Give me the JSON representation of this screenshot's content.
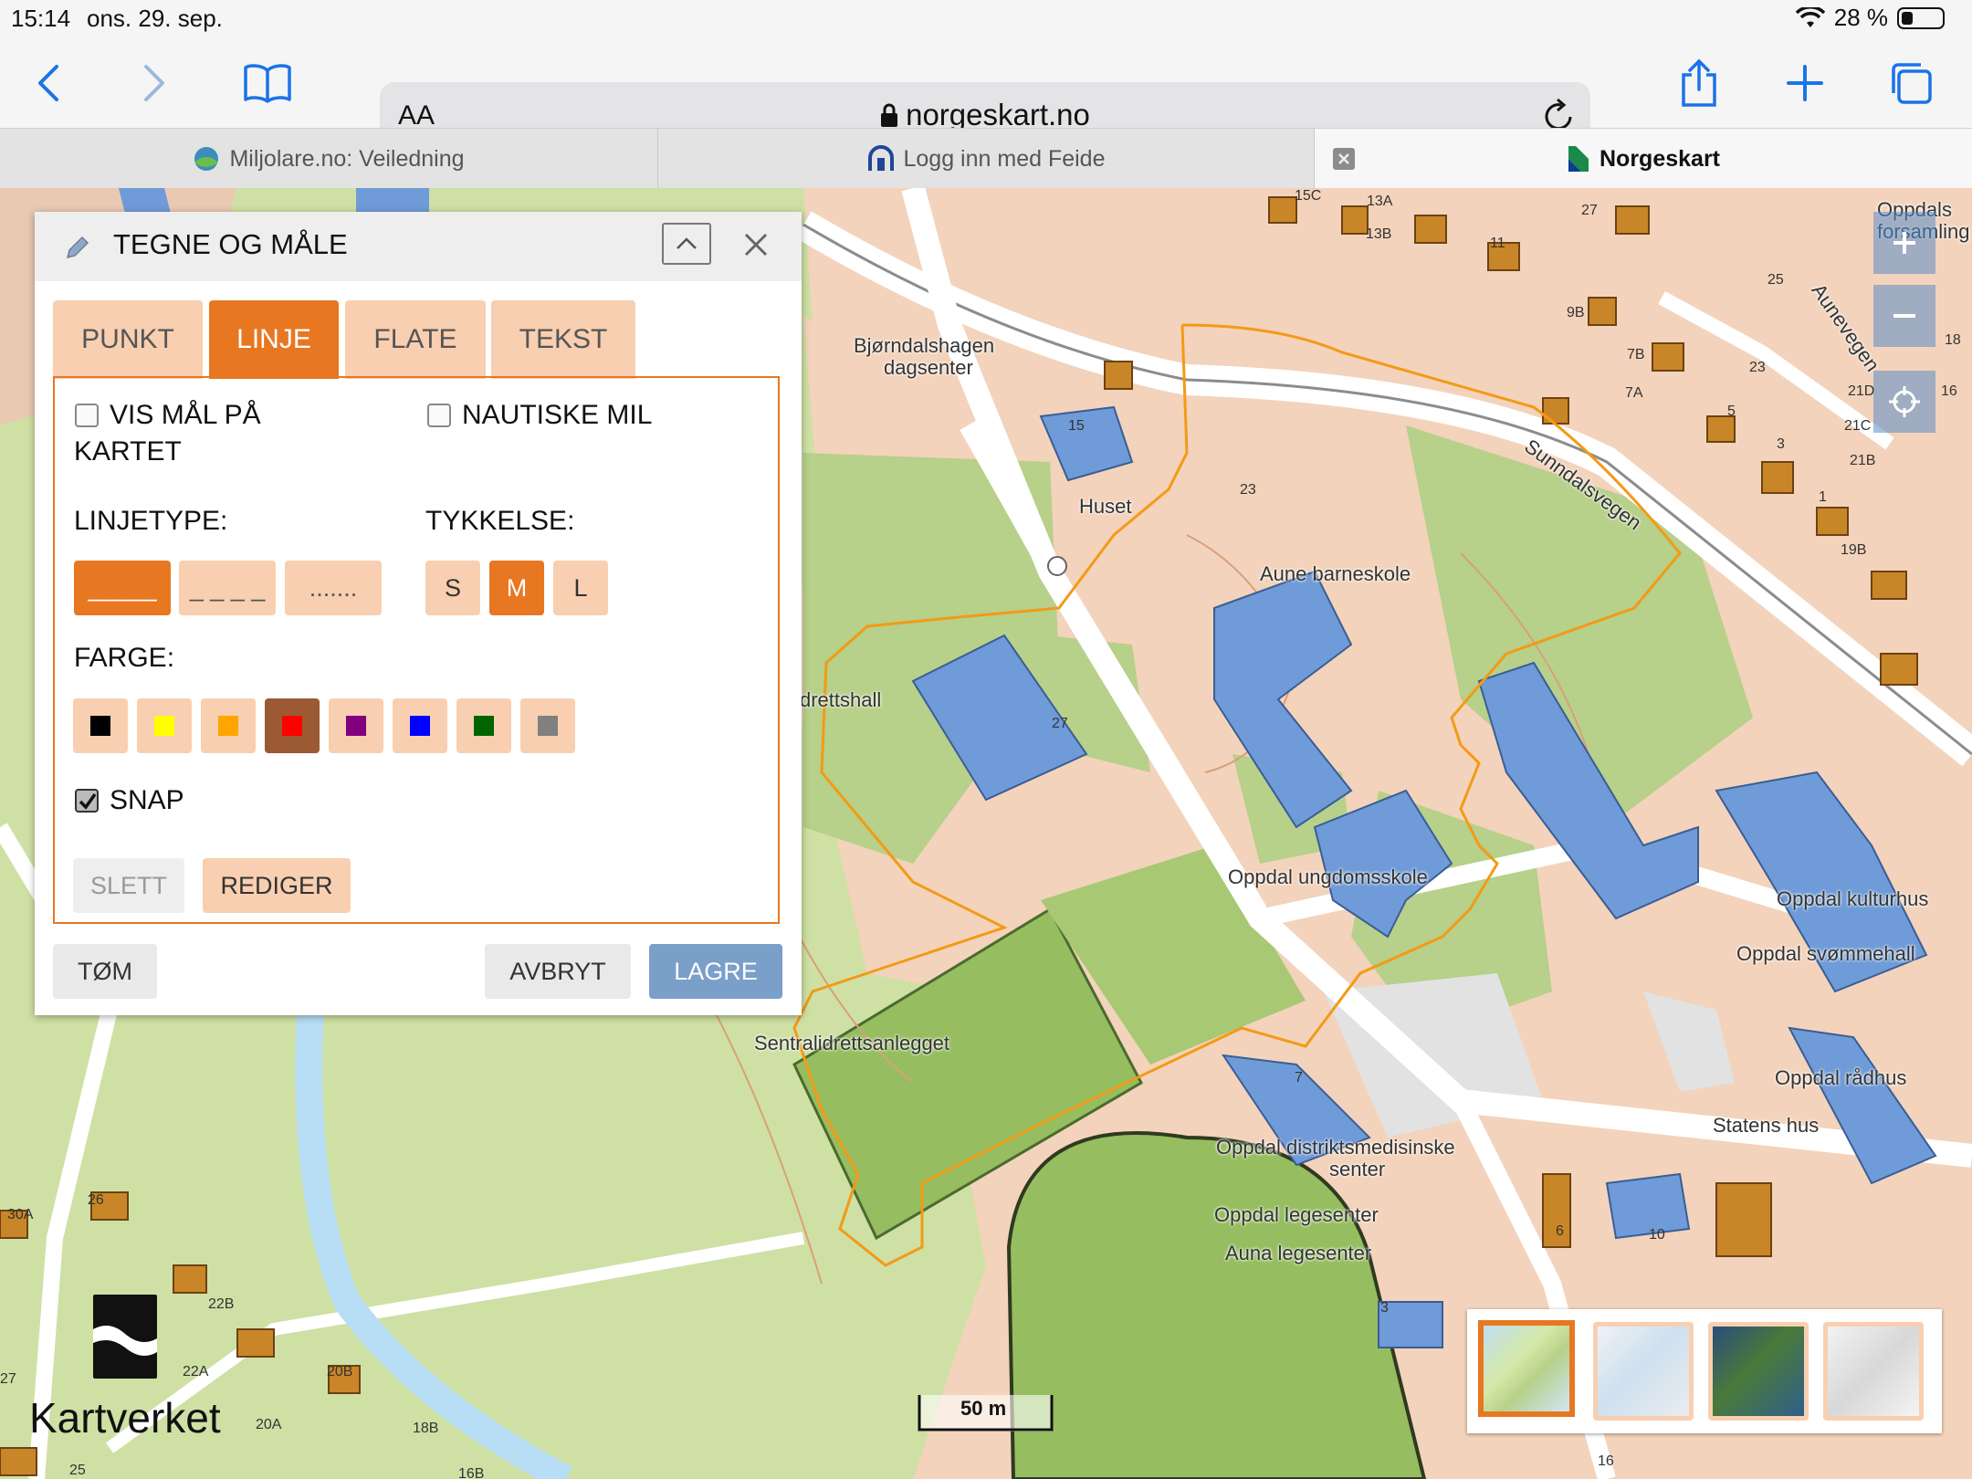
{
  "status": {
    "time": "15:14",
    "date": "ons. 29. sep.",
    "battery": "28 %",
    "battery_level": 0.28
  },
  "browser": {
    "aa_label": "AA",
    "url": "norgeskart.no",
    "tabs": [
      {
        "label": "Miljolare.no: Veiledning"
      },
      {
        "label": "Logg inn med Feide"
      },
      {
        "label": "Norgeskart"
      }
    ]
  },
  "panel": {
    "title": "TEGNE OG MÅLE",
    "tabs": [
      "PUNKT",
      "LINJE",
      "FLATE",
      "TEKST"
    ],
    "active_tab": "LINJE",
    "show_measure_label": "VIS MÅL PÅ KARTET",
    "show_measure_line1": "VIS MÅL PÅ",
    "show_measure_line2": "KARTET",
    "nautical_label": "NAUTISKE MIL",
    "linetype_label": "LINJETYPE:",
    "linetypes": [
      "_____",
      "_ _ _ _",
      "......."
    ],
    "thickness_label": "TYKKELSE:",
    "thickness": [
      "S",
      "M",
      "L"
    ],
    "selected_thickness": "M",
    "color_label": "FARGE:",
    "colors": [
      "#000000",
      "#ffff00",
      "#ffa500",
      "#ff0000",
      "#800080",
      "#0000ff",
      "#006400",
      "#808080"
    ],
    "selected_color": "#ff0000",
    "snap_label": "SNAP",
    "snap_checked": true,
    "delete_label": "SLETT",
    "edit_label": "REDIGER",
    "clear_label": "TØM",
    "cancel_label": "AVBRYT",
    "save_label": "LAGRE"
  },
  "map": {
    "labels": {
      "bjorn1": "Bjørndalshagen",
      "bjorn2": "dagsenter",
      "huset": "Huset",
      "aune": "Aune barneskole",
      "idrettshall": "drettshall",
      "ungdom": "Oppdal ungdomsskole",
      "kultur": "Oppdal kulturhus",
      "svommehall": "Oppdal svømmehall",
      "sentral": "Sentralidrettsanlegget",
      "radhus": "Oppdal rådhus",
      "statens": "Statens hus",
      "distrikt1": "Oppdal distriktsmedisinske",
      "distrikt2": "senter",
      "lege": "Oppdal legesenter",
      "auna": "Auna legesenter",
      "sunndal": "Sunndalsvegen",
      "aune_vegen": "Aunevegen",
      "forsamling": "Oppdals forsamling",
      "scale": "50 m",
      "logo": "Kartverket"
    },
    "house_numbers": [
      "15C",
      "13A",
      "13B",
      "11",
      "27",
      "9B",
      "7B",
      "7A",
      "25",
      "23",
      "5",
      "3",
      "1",
      "21D",
      "21C",
      "21B",
      "19B",
      "15",
      "23",
      "27",
      "16",
      "18",
      "30A",
      "26",
      "22B",
      "22A",
      "20B",
      "20A",
      "18B",
      "16B",
      "25",
      "27",
      "10",
      "6",
      "3",
      "16",
      "7"
    ],
    "basemaps": [
      "topo",
      "grey",
      "aerial",
      "sketch"
    ],
    "selected_basemap": "topo",
    "accent_orange": "#e87722",
    "building_blue": "#6f9bd8"
  }
}
